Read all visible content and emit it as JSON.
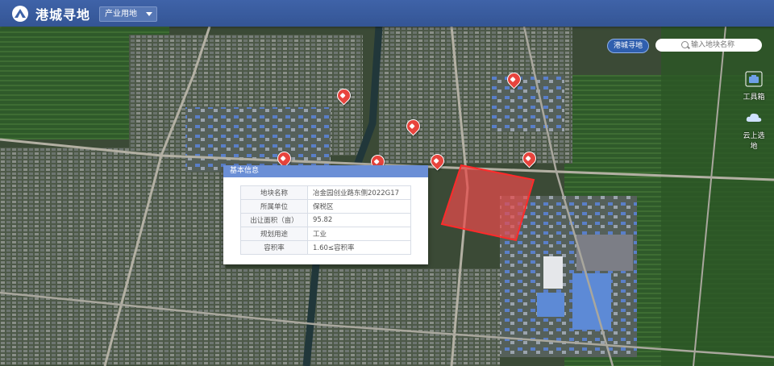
{
  "header": {
    "title": "港城寻地",
    "category": "产业用地"
  },
  "map_tag": "港城寻地",
  "search": {
    "placeholder": "输入地块名称"
  },
  "tools": [
    {
      "label": "工具箱",
      "icon": "toolbox-icon"
    },
    {
      "label": "云上选地",
      "icon": "cloud-icon"
    }
  ],
  "popup": {
    "title": "基本信息",
    "rows": [
      {
        "key": "地块名称",
        "value": "冶金园创业路东侧2022G17"
      },
      {
        "key": "所属单位",
        "value": "保税区"
      },
      {
        "key": "出让面积（亩）",
        "value": "95.82"
      },
      {
        "key": "规划用途",
        "value": "工业"
      },
      {
        "key": "容积率",
        "value": "1.60≤容积率"
      }
    ]
  },
  "colors": {
    "header": "#3f63a8",
    "parcel_fill": "#e84b4b",
    "marker": "#e8443d",
    "popup_head": "#6b8fd6"
  }
}
